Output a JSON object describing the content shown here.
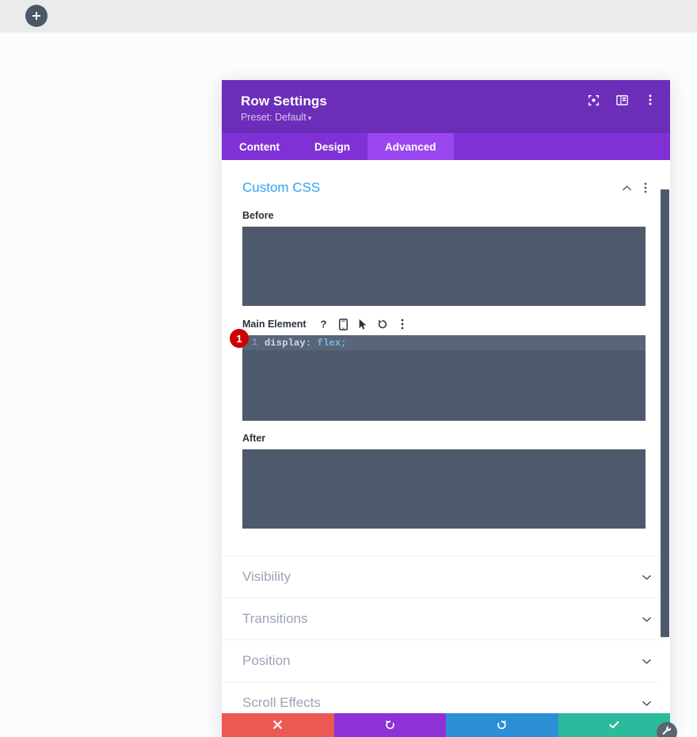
{
  "toolbar": {
    "add_label": "+",
    "add_icon": "plus-icon"
  },
  "modal": {
    "title": "Row Settings",
    "preset_label": "Preset: Default",
    "preset_caret": "▾",
    "header_icons": [
      {
        "name": "focus-target-icon"
      },
      {
        "name": "panel-layout-icon"
      },
      {
        "name": "more-vertical-icon"
      }
    ],
    "tabs": [
      {
        "label": "Content",
        "active": false
      },
      {
        "label": "Design",
        "active": false
      },
      {
        "label": "Advanced",
        "active": true
      }
    ]
  },
  "custom_css": {
    "title": "Custom CSS",
    "collapse_icon": "chevron-up-icon",
    "more_icon": "more-vertical-icon",
    "before": {
      "label": "Before",
      "value": "",
      "placeholder": ""
    },
    "main_element": {
      "label": "Main Element",
      "icons": [
        {
          "name": "help-icon",
          "glyph": "?"
        },
        {
          "name": "responsive-mobile-icon"
        },
        {
          "name": "hover-cursor-icon"
        },
        {
          "name": "reset-undo-icon"
        },
        {
          "name": "more-vertical-icon"
        }
      ],
      "badge": "1",
      "lines": [
        {
          "number": "1",
          "property": "display",
          "colon": ":",
          "value": "flex",
          "semicolon": ";"
        }
      ]
    },
    "after": {
      "label": "After",
      "value": "",
      "placeholder": ""
    }
  },
  "sections": [
    {
      "label": "Visibility",
      "icon": "chevron-down-icon"
    },
    {
      "label": "Transitions",
      "icon": "chevron-down-icon"
    },
    {
      "label": "Position",
      "icon": "chevron-down-icon"
    },
    {
      "label": "Scroll Effects",
      "icon": "chevron-down-icon"
    }
  ],
  "actions": [
    {
      "name": "discard-button",
      "icon": "close-x-icon",
      "color": "#eb5a52"
    },
    {
      "name": "undo-button",
      "icon": "undo-icon",
      "color": "#8c32d6"
    },
    {
      "name": "redo-button",
      "icon": "redo-icon",
      "color": "#2c8fd6"
    },
    {
      "name": "save-button",
      "icon": "check-icon",
      "color": "#2bbb9c"
    }
  ],
  "fab": {
    "name": "wrench-settings-icon"
  },
  "colors": {
    "header_purple": "#6c2eb9",
    "tab_bar_purple": "#8031d6",
    "tab_active_purple": "#9a47ef",
    "editor_dark": "#4e5a6b",
    "accent_blue": "#2ea3f2",
    "badge_red": "#cc0000"
  }
}
